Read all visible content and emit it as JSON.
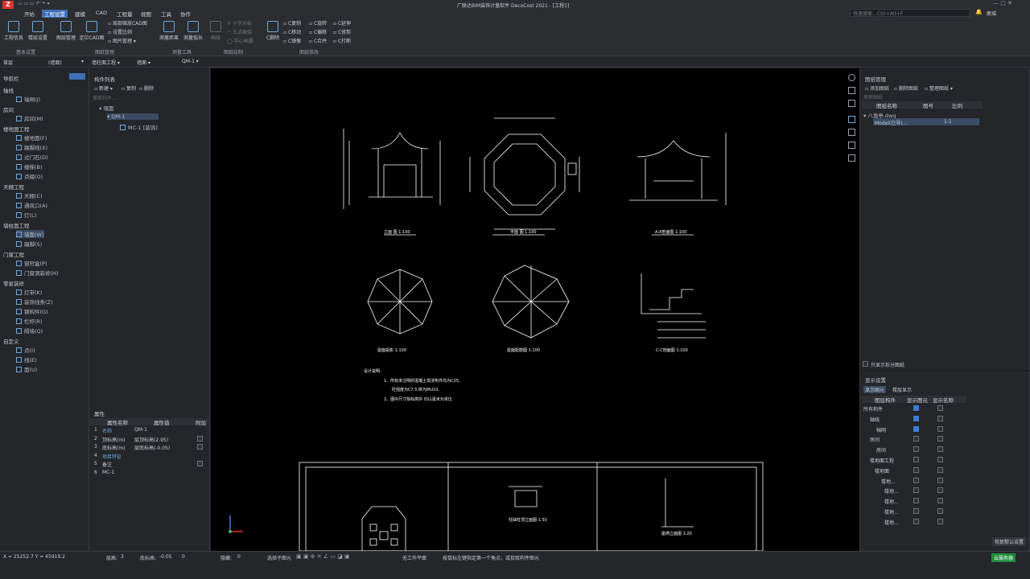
{
  "app_title": "广联达BIM装饰计量软件 DecoCost 2021 - [工程1]",
  "search_placeholder": "快速搜索…Ctrl+Alt+F",
  "user": "鹿城",
  "menu": [
    "开始",
    "工程设置",
    "建模",
    "CAD",
    "工程量",
    "视图",
    "工具",
    "协作"
  ],
  "ribbon": {
    "basic": {
      "label": "基本设置",
      "btns": [
        "工程信息",
        "楼层设置"
      ]
    },
    "drawing": {
      "label": "图纸管理",
      "btns": [
        "图层管理",
        "定位CAD图"
      ],
      "small": [
        "局部缩放CAD图",
        "设置比例",
        "图片管理"
      ]
    },
    "measure": {
      "label": "测量工具",
      "btns": [
        "测量距离",
        "测量弧长"
      ]
    },
    "draw": {
      "label": "图纸绘制",
      "btns": [
        "画线"
      ],
      "small": [
        "十字光标",
        "三点画弧",
        "中心画圆"
      ]
    },
    "edit": {
      "label": "图纸修改",
      "btns": [
        "C删除"
      ],
      "small": [
        "C复制",
        "C移动",
        "C镜像",
        "C旋转",
        "C偏移",
        "C合并",
        "C延伸",
        "C修剪",
        "C打断"
      ]
    }
  },
  "selbar": [
    "首层",
    "(墙面)",
    "墙柱面工程",
    "墙面",
    "QM-1"
  ],
  "nav": {
    "title": "导航栏",
    "groups": [
      {
        "name": "轴线",
        "items": [
          "轴网(J)"
        ]
      },
      {
        "name": "房间",
        "items": [
          "房间(M)"
        ]
      },
      {
        "name": "楼地面工程",
        "items": [
          "楼地面(F)",
          "踢脚线(X)",
          "过门石(D)",
          "楼梯(B)",
          "点缀(O)"
        ]
      },
      {
        "name": "天棚工程",
        "items": [
          "天棚(C)",
          "通风口(A)",
          "灯(L)"
        ]
      },
      {
        "name": "墙柱面工程",
        "items": [
          "墙面(W)",
          "踢脚(S)"
        ]
      },
      {
        "name": "门窗工程",
        "items": [
          "窗帘盒(P)",
          "门窗洞装修(H)"
        ]
      },
      {
        "name": "零星装修",
        "items": [
          "灯带(K)",
          "装饰线条(Z)",
          "钢构件(G)",
          "栏杆(R)",
          "隔墙(Q)"
        ]
      },
      {
        "name": "自定义",
        "items": [
          "点(I)",
          "线(E)",
          "面(U)"
        ]
      }
    ]
  },
  "components": {
    "title": "构件列表",
    "new": "新建",
    "copy": "复制",
    "del": "删除",
    "search": "搜索构件...",
    "root": "墙面",
    "item": "QM-1",
    "child": "MC-1 [装饰]"
  },
  "props": {
    "title": "属性",
    "headers": [
      "属性名称",
      "属性值",
      "附加"
    ],
    "rows": [
      [
        "1",
        "名称",
        "QM-1"
      ],
      [
        "2",
        "顶标高(m)",
        "层顶标高(2.95)"
      ],
      [
        "3",
        "底标高(m)",
        "层底标高(-0.05)"
      ],
      [
        "4",
        "项目特征",
        ""
      ],
      [
        "5",
        "备注",
        ""
      ],
      [
        "6",
        "MC-1",
        ""
      ]
    ]
  },
  "drawing_mgr": {
    "title": "图纸管理",
    "add": "添加图纸",
    "del": "删除图纸",
    "org": "整理图纸",
    "search": "搜索图纸",
    "headers": [
      "图纸名称",
      "图号",
      "比例"
    ],
    "file": "八角亭.dwg",
    "model": "Model(已导)...",
    "scale": "1:1",
    "only_split": "只显示拆分图纸"
  },
  "display": {
    "title": "显示设置",
    "tabs": [
      "显示图元",
      "楼层显示"
    ],
    "headers": [
      "图层构件",
      "显示图元",
      "显示名称"
    ],
    "rows": [
      [
        "所有构件",
        true,
        false
      ],
      [
        "轴线",
        true,
        false
      ],
      [
        "轴网",
        true,
        false
      ],
      [
        "房间",
        false,
        false
      ],
      [
        "房间",
        false,
        false
      ],
      [
        "楼地面工程",
        false,
        false
      ],
      [
        "楼地面",
        false,
        false
      ],
      [
        "楼地...",
        false,
        false
      ],
      [
        "楼地...",
        false,
        false
      ],
      [
        "楼地...",
        false,
        false
      ],
      [
        "楼地...",
        false,
        false
      ],
      [
        "楼地...",
        false,
        false
      ]
    ],
    "restore": "恢复默认设置"
  },
  "cad": {
    "titles": [
      "立面  图 1:100",
      "平面  图 1:100",
      "A-A剖面图 1:100",
      "屋面投影  1:100",
      "屋面配筋图 1:100",
      "C-C剖面图 1:100",
      "柱础柱顶立面图 1:50",
      "座椅立面图 1:20"
    ],
    "notes": [
      "设计说明:",
      "1、所有未注明的混凝土现浇构件均为C25,",
      "砼强度为C7.5 砖为MU10,",
      "2、图中尺寸除标高外 均以毫米为单位"
    ]
  },
  "status": {
    "coords": "X = 25252.7 Y = 45919.2",
    "floor_label": "层高:",
    "floor": "3",
    "base_label": "底标高:",
    "base": "-0.05",
    "zero": "0",
    "hidden_label": "隐藏:",
    "hidden": "0",
    "select": "选择子图元",
    "plane": "无工作平面",
    "hint": "按鼠标左键指定第一个角点，或拾取构件图元",
    "cloud": "云服务器"
  }
}
